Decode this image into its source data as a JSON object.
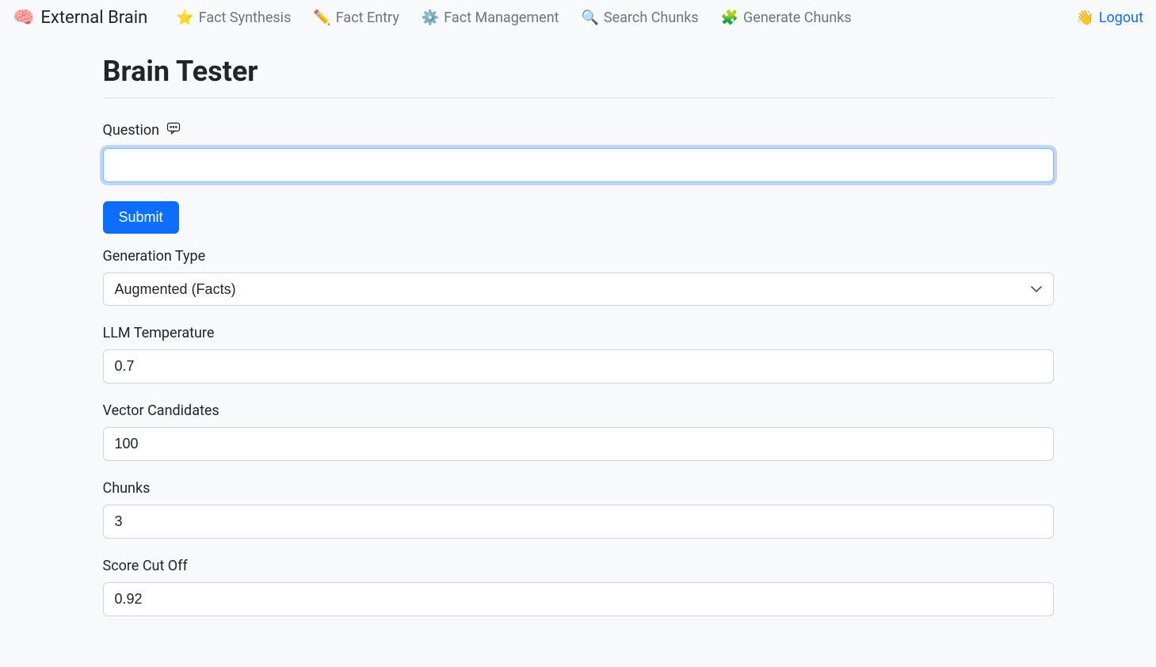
{
  "navbar": {
    "brand": "External Brain",
    "links": [
      {
        "label": "Fact Synthesis"
      },
      {
        "label": "Fact Entry"
      },
      {
        "label": "Fact Management"
      },
      {
        "label": "Search Chunks"
      },
      {
        "label": "Generate Chunks"
      }
    ],
    "logout": "Logout"
  },
  "page": {
    "title": "Brain Tester"
  },
  "form": {
    "question": {
      "label": "Question",
      "value": ""
    },
    "submit_label": "Submit",
    "generation_type": {
      "label": "Generation Type",
      "selected": "Augmented (Facts)"
    },
    "llm_temperature": {
      "label": "LLM Temperature",
      "value": "0.7"
    },
    "vector_candidates": {
      "label": "Vector Candidates",
      "value": "100"
    },
    "chunks": {
      "label": "Chunks",
      "value": "3"
    },
    "score_cut_off": {
      "label": "Score Cut Off",
      "value": "0.92"
    }
  }
}
